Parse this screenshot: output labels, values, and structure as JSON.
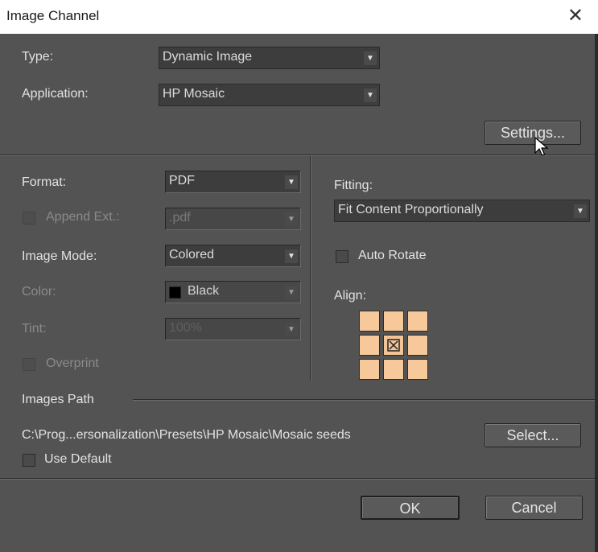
{
  "window": {
    "title": "Image Channel"
  },
  "icons": {
    "close": "close-icon",
    "dropdown": "chevron-down-icon",
    "cursor": "mouse-pointer-icon",
    "center": "center-x-icon"
  },
  "type": {
    "label": "Type:",
    "value": "Dynamic Image"
  },
  "application": {
    "label": "Application:",
    "value": "HP Mosaic"
  },
  "settings_button": "Settings...",
  "format": {
    "label": "Format:",
    "value": "PDF"
  },
  "append_ext": {
    "label": "Append Ext.:",
    "value": ".pdf",
    "enabled": false
  },
  "image_mode": {
    "label": "Image Mode:",
    "value": "Colored"
  },
  "color": {
    "label": "Color:",
    "value": "Black",
    "swatch": "#000000",
    "enabled": false
  },
  "tint": {
    "label": "Tint:",
    "value": "100%",
    "enabled": false
  },
  "overprint": {
    "label": "Overprint",
    "enabled": false
  },
  "fitting": {
    "label": "Fitting:",
    "value": "Fit Content Proportionally"
  },
  "auto_rotate": {
    "label": "Auto Rotate",
    "checked": false
  },
  "align": {
    "label": "Align:",
    "selected": "center",
    "tile_color": "#f7c99a"
  },
  "images_path": {
    "label": "Images Path",
    "path": "C:\\Prog...ersonalization\\Presets\\HP Mosaic\\Mosaic seeds",
    "select_button": "Select...",
    "use_default": {
      "label": "Use Default",
      "checked": false
    }
  },
  "buttons": {
    "ok": "OK",
    "cancel": "Cancel"
  }
}
